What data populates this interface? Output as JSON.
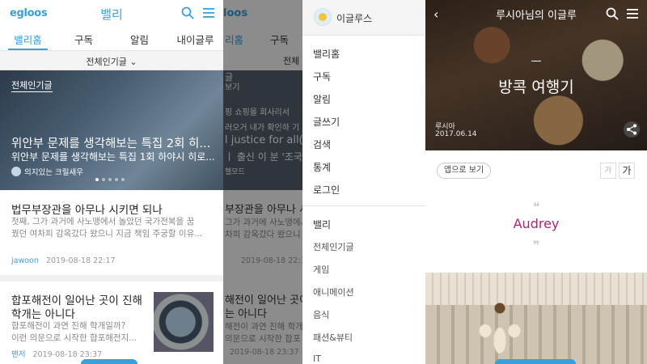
{
  "panel1": {
    "logo": "egloos",
    "title": "밸리",
    "tabs": [
      "밸리홈",
      "구독",
      "알림",
      "내이글루"
    ],
    "filter": "전체인기글 ⌄",
    "hero": {
      "tag": "전체인기글",
      "title": "위안부 문제를 생각해보는 특집 2회 히...",
      "subtitle": "위안부 문제를 생각해보는 특집 1회 하야시 히로...",
      "author": "의지있는 크릴새우"
    },
    "posts": [
      {
        "title": "법무부장관을 아무나 시키면 되나",
        "body1": "첫째, 그가 과거에 사노맹에서 놀았던 국가전복을 꿈",
        "body2": "꿨던 여차피 감옥갔다 왔으니 지금 책임 주궁할 이유...",
        "author": "jawoon",
        "date": "2019-08-18 22:17"
      },
      {
        "title1": "합포해전이 일어난 곳이 진해",
        "title2": "학개는 아니다",
        "body1": "합포해전이 과연 진해 학개일까?",
        "body2": "이런 의문으로 시작한 합포해전지...",
        "author": "팬저",
        "date": "2019-08-18 23:37"
      }
    ]
  },
  "panel2": {
    "logo": "loos",
    "tab1": "리홈",
    "tab2": "구독",
    "filter": "전체",
    "hero_lines": [
      "글",
      "보기",
      "핑 쇼핑몰 회사리서",
      "러오거 내가 확인하 기",
      "l justice for all(?)",
      "ㅣ 출신 이 분 '조국",
      "헬모드",
      "부장관을 아무나 시",
      "그가 과거에 사노맹에서",
      "차피 감옥갔다 왔으니",
      "2019-08-18 22:17",
      "해전이 일어난 곳이 진",
      "는 아니다",
      "해전이 과연 진해 학개",
      "의문으로 시작한 합포",
      "2019-08-18 23:37"
    ]
  },
  "menu": {
    "user": "이글루스",
    "items1": [
      "밸리홈",
      "구독",
      "알림",
      "글쓰기",
      "검색",
      "통계",
      "로그인"
    ],
    "section": "밸리",
    "items2": [
      "전체인기글",
      "게임",
      "애니메이션",
      "음식",
      "패션&뷰티",
      "IT"
    ]
  },
  "blog": {
    "header_title": "루시아님의 이글루",
    "post_title": "방콕 여행기",
    "author": "루시아",
    "date": "2017.06.14",
    "app_button": "앱으로 보기",
    "font_small": "가",
    "font_large": "가",
    "quote_open": "❝",
    "quote_close": "❞",
    "highlight": "Audrey"
  },
  "colors": {
    "accent": "#3aa0dc",
    "pink": "#b31e7a"
  }
}
